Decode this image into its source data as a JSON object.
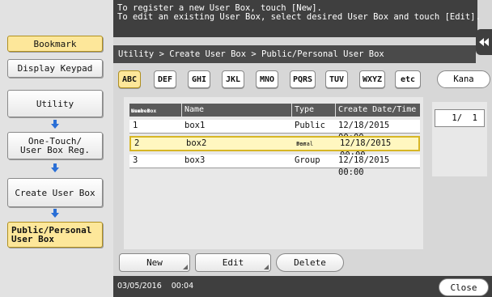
{
  "message": {
    "line1": "To register a new User Box, touch [New].",
    "line2": "To edit an existing User Box, select desired User Box and touch [Edit]."
  },
  "sidebar": {
    "bookmark": "Bookmark",
    "display_keypad": "Display Keypad",
    "steps": [
      {
        "label": "Utility"
      },
      {
        "label_line1": "One-Touch/",
        "label_line2": "User Box Reg."
      },
      {
        "label": "Create User Box"
      },
      {
        "label_line1": "Public/Personal",
        "label_line2": "User Box"
      }
    ]
  },
  "breadcrumb": "Utility > Create User Box > Public/Personal User Box",
  "index_tabs": [
    "ABC",
    "DEF",
    "GHI",
    "JKL",
    "MNO",
    "PQRS",
    "TUV",
    "WXYZ",
    "etc"
  ],
  "kana_label": "Kana",
  "table": {
    "headers": {
      "number_line1": "User Box",
      "number_line2": "Number",
      "name": "Name",
      "type": "Type",
      "date": "Create Date/Time"
    },
    "rows": [
      {
        "number": "1",
        "name": "box1",
        "type": "Public",
        "date": "12/18/2015 00:00"
      },
      {
        "number": "2",
        "name": "box2",
        "type_line1": "Per-",
        "type_line2": "sonal",
        "date": "12/18/2015 00:00",
        "selected": true
      },
      {
        "number": "3",
        "name": "box3",
        "type": "Group",
        "date": "12/18/2015 00:00"
      }
    ]
  },
  "pager": {
    "page": "1/  1"
  },
  "buttons": {
    "new": "New",
    "edit": "Edit",
    "delete": "Delete",
    "close": "Close"
  },
  "footer": {
    "date": "03/05/2016",
    "time": "00:04"
  },
  "icons": {
    "expander": "double-chevron-left-icon",
    "step_arrow": "arrow-down-icon"
  },
  "colors": {
    "selected": "#fde79a",
    "header_dark": "#3f3f3f",
    "arrow_blue": "#2a6fd6"
  }
}
